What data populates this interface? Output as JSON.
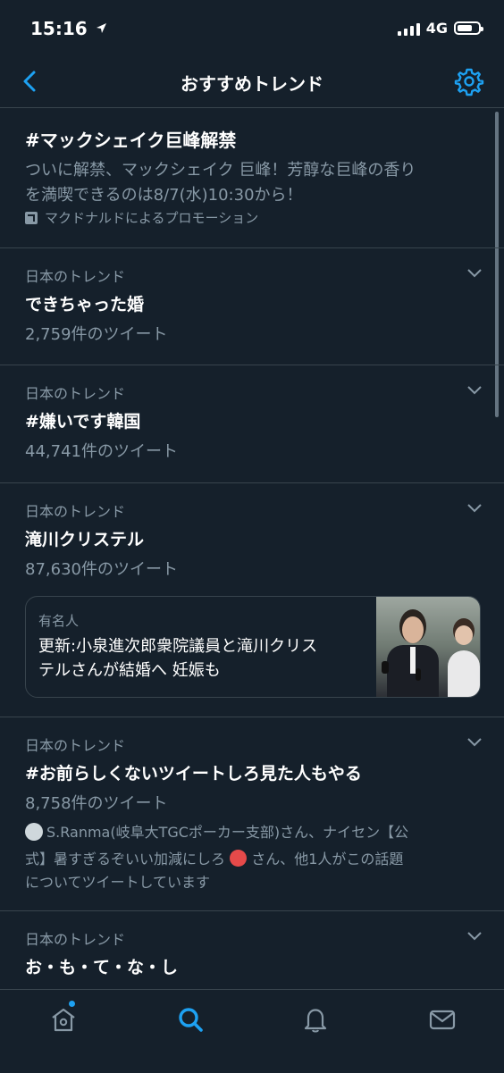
{
  "status": {
    "time": "15:16",
    "network": "4G"
  },
  "header": {
    "title": "おすすめトレンド"
  },
  "promoted": {
    "name": "#マックシェイク巨峰解禁",
    "description_line1": "ついに解禁、マックシェイク 巨峰！芳醇な巨峰の香り",
    "description_line2": "を満喫できるのは8/7(水)10:30から！",
    "promoter": "マクドナルドによるプロモーション"
  },
  "trends": [
    {
      "context": "日本のトレンド",
      "name": "できちゃった婚",
      "count": "2,759件のツイート"
    },
    {
      "context": "日本のトレンド",
      "name": "#嫌いです韓国",
      "count": "44,741件のツイート"
    },
    {
      "context": "日本のトレンド",
      "name": "滝川クリステル",
      "count": "87,630件のツイート",
      "card": {
        "category": "有名人",
        "line1": "更新:小泉進次郎衆院議員と滝川クリス",
        "line2": "テルさんが結婚へ 妊娠も"
      }
    },
    {
      "context": "日本のトレンド",
      "name": "#お前らしくないツイートしろ見た人もやる",
      "count": "8,758件のツイート",
      "social": {
        "line1": "S.Ranma(岐阜大TGCポーカー支部)さん、ナイセン【公",
        "line2a": "式】暑すぎるぞいい加減にしろ",
        "line2b": "さん、他1人がこの話題",
        "line3": "についてツイートしています"
      }
    },
    {
      "context": "日本のトレンド",
      "name": "お・も・て・な・し"
    }
  ],
  "icons": {
    "back": "chevron-left-icon",
    "settings": "gear-icon",
    "chevron": "chevron-down-icon",
    "home": "home-icon",
    "search": "search-icon",
    "notifications": "bell-icon",
    "messages": "mail-icon"
  },
  "colors": {
    "background": "#15202b",
    "accent": "#1da1f2",
    "secondary_text": "#8899a6",
    "divider": "#38444d"
  }
}
